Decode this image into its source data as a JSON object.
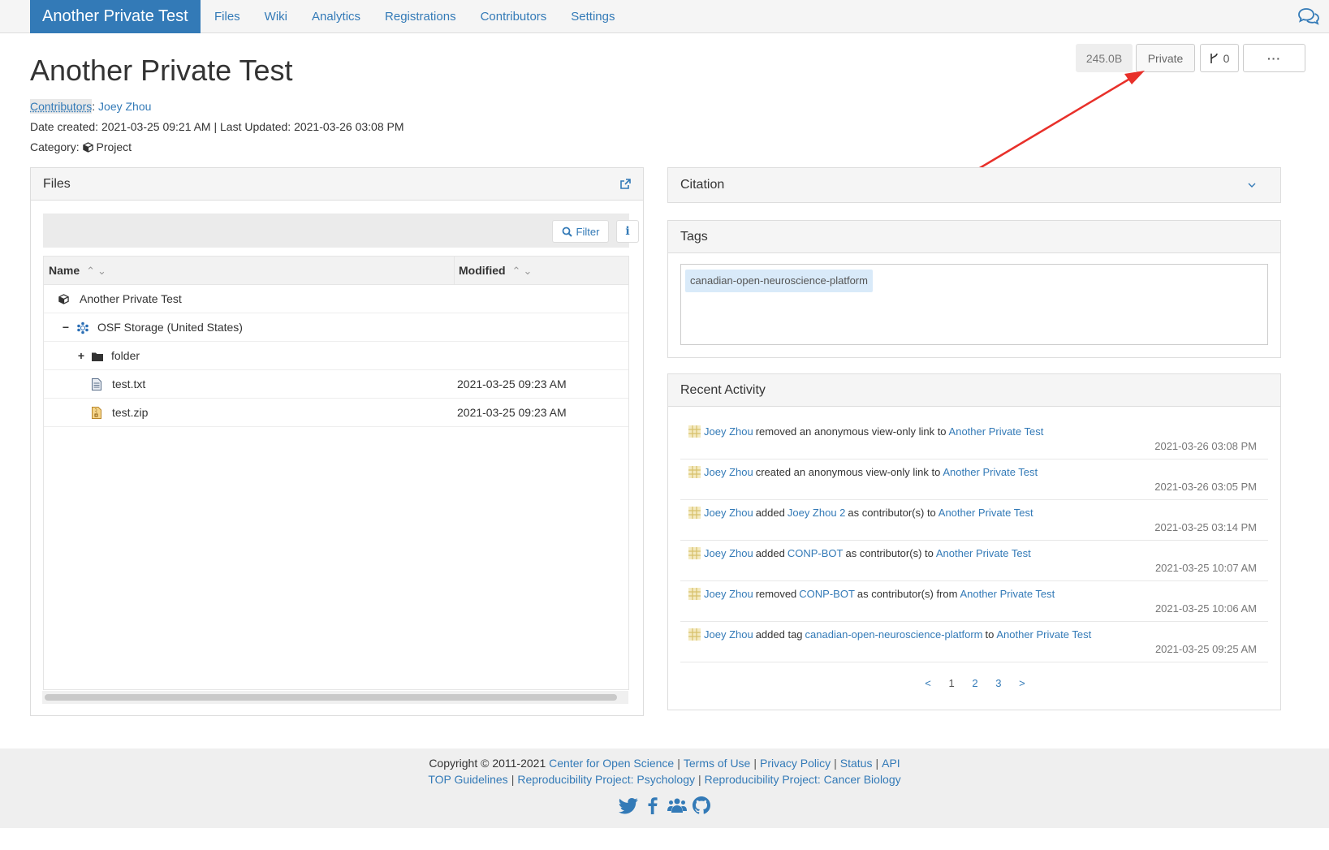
{
  "nav": {
    "brand": "Another Private Test",
    "links": [
      "Files",
      "Wiki",
      "Analytics",
      "Registrations",
      "Contributors",
      "Settings"
    ]
  },
  "header": {
    "title": "Another Private Test",
    "contributors_label": "Contributors",
    "contributors_sep": ":",
    "contributor": "Joey Zhou",
    "dates": "Date created: 2021-03-25 09:21 AM | Last Updated: 2021-03-26 03:08 PM",
    "category_label": "Category:",
    "category": "Project",
    "size": "245.0B",
    "privacy": "Private",
    "fork_count": "0",
    "more": "···"
  },
  "files": {
    "title": "Files",
    "filter_label": "Filter",
    "info_label": "i",
    "col_name": "Name",
    "col_modified": "Modified",
    "rows": [
      {
        "name": "Another Private Test",
        "toggle": "",
        "modified": ""
      },
      {
        "name": "OSF Storage (United States)",
        "toggle": "−",
        "modified": ""
      },
      {
        "name": "folder",
        "toggle": "+",
        "modified": ""
      },
      {
        "name": "test.txt",
        "toggle": "",
        "modified": "2021-03-25 09:23 AM"
      },
      {
        "name": "test.zip",
        "toggle": "",
        "modified": "2021-03-25 09:23 AM"
      }
    ]
  },
  "citation": {
    "title": "Citation"
  },
  "tags": {
    "title": "Tags",
    "items": [
      "canadian-open-neuroscience-platform"
    ]
  },
  "activity": {
    "title": "Recent Activity",
    "items": [
      {
        "user": "Joey Zhou",
        "parts": [
          "removed an anonymous view-only link to"
        ],
        "target": "Another Private Test",
        "time": "2021-03-26 03:08 PM"
      },
      {
        "user": "Joey Zhou",
        "parts": [
          "created an anonymous view-only link to"
        ],
        "target": "Another Private Test",
        "time": "2021-03-26 03:05 PM"
      },
      {
        "user": "Joey Zhou",
        "verb": "added",
        "object": "Joey Zhou 2",
        "mid": "as contributor(s) to",
        "target": "Another Private Test",
        "time": "2021-03-25 03:14 PM"
      },
      {
        "user": "Joey Zhou",
        "verb": "added",
        "object": "CONP-BOT",
        "mid": "as contributor(s) to",
        "target": "Another Private Test",
        "time": "2021-03-25 10:07 AM"
      },
      {
        "user": "Joey Zhou",
        "verb": "removed",
        "object": "CONP-BOT",
        "mid": "as contributor(s) from",
        "target": "Another Private Test",
        "time": "2021-03-25 10:06 AM"
      },
      {
        "user": "Joey Zhou",
        "verb": "added tag",
        "object": "canadian-open-neuroscience-platform",
        "mid": "to",
        "target": "Another Private Test",
        "time": "2021-03-25 09:25 AM"
      }
    ],
    "pager": [
      "<",
      "1",
      "2",
      "3",
      ">"
    ]
  },
  "footer": {
    "copyright": "Copyright © 2011-2021",
    "links1": [
      "Center for Open Science",
      "Terms of Use",
      "Privacy Policy",
      "Status",
      "API"
    ],
    "links2": [
      "TOP Guidelines",
      "Reproducibility Project: Psychology",
      "Reproducibility Project: Cancer Biology"
    ]
  },
  "colors": {
    "accent": "#337ab7",
    "annotation_arrow": "#e8302a"
  }
}
